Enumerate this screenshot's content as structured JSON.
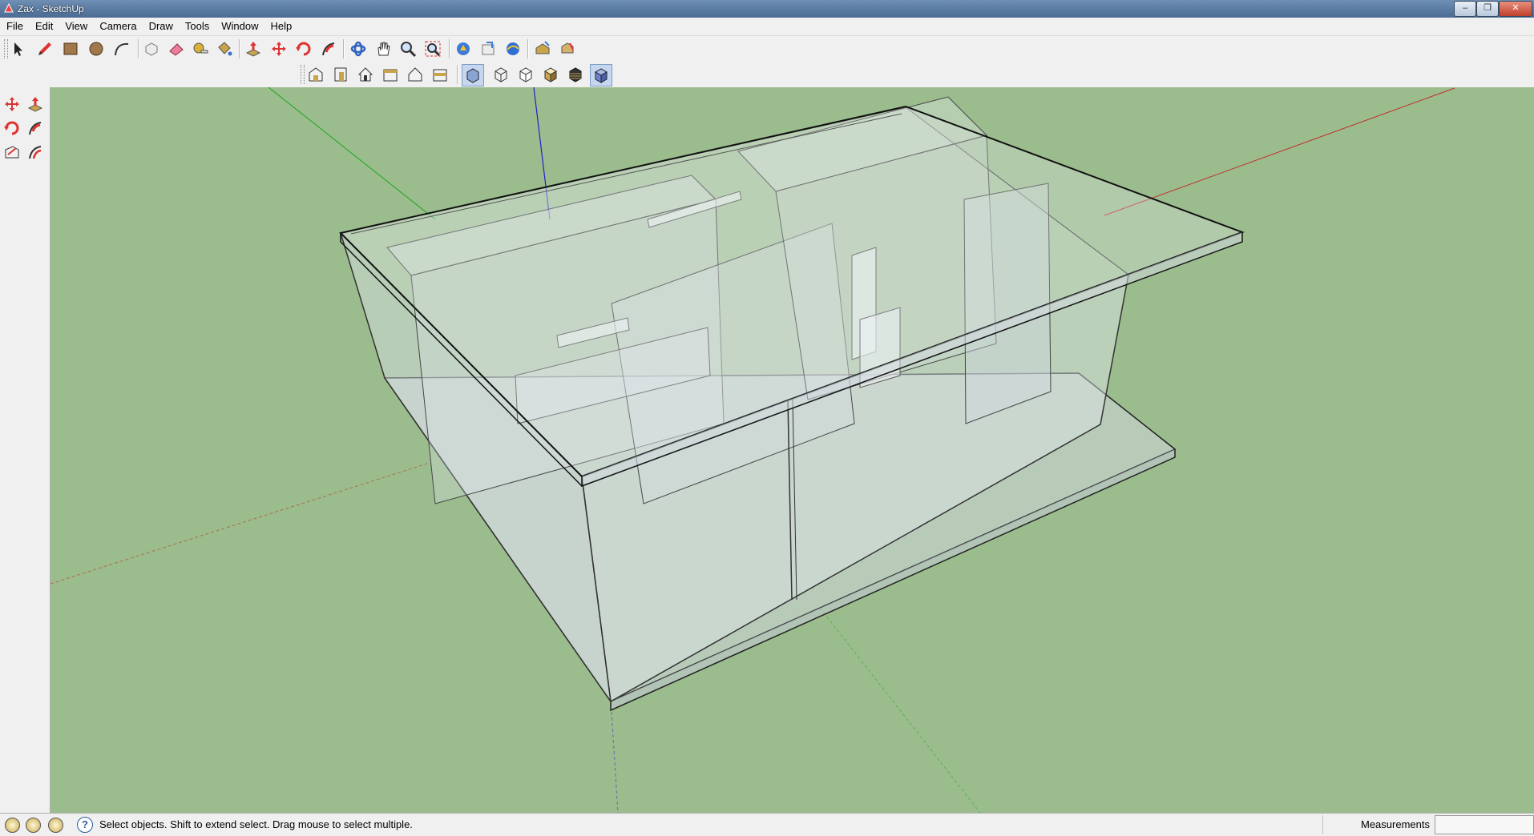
{
  "window": {
    "title": "Zax - SketchUp",
    "controls": [
      "minimize",
      "restore",
      "close"
    ]
  },
  "menu": {
    "items": [
      "File",
      "Edit",
      "View",
      "Camera",
      "Draw",
      "Tools",
      "Window",
      "Help"
    ]
  },
  "toolbar": {
    "row1": [
      "select-icon",
      "pencil-icon",
      "rectangle-icon",
      "circle-icon",
      "arc-icon",
      "make-component-icon",
      "eraser-icon",
      "tape-measure-icon",
      "paint-bucket-icon",
      "push-pull-icon",
      "move-icon",
      "rotate-icon",
      "follow-me-icon",
      "orbit-icon",
      "pan-icon",
      "zoom-icon",
      "zoom-extents-icon",
      "get-models-icon",
      "share-model-icon",
      "google-earth-icon",
      "get-photo-texture-icon",
      "add-location-icon"
    ],
    "row2": [
      "iso-view-icon",
      "front-view-icon",
      "house-view-icon",
      "right-view-icon",
      "back-view-icon",
      "left-view-icon",
      "xray-style-icon",
      "wireframe-style-icon",
      "hidden-line-style-icon",
      "shaded-style-icon",
      "shaded-textures-style-icon",
      "monochrome-style-icon"
    ]
  },
  "palette": [
    "move-icon",
    "push-pull-icon",
    "rotate-icon",
    "follow-me-icon",
    "scale-icon",
    "offset-icon"
  ],
  "status": {
    "icons": [
      "geolocation-icon",
      "credits-icon",
      "signin-icon"
    ],
    "hint": "Select objects. Shift to extend select. Drag mouse to select multiple.",
    "measurements_label": "Measurements",
    "measurements_value": ""
  },
  "colors": {
    "sky_ground": "#9bbd8e",
    "red_axis": "#c0302a",
    "green_axis": "#1aa51a",
    "blue_axis": "#2020c8",
    "xray_fill": "#dfe6ee"
  }
}
